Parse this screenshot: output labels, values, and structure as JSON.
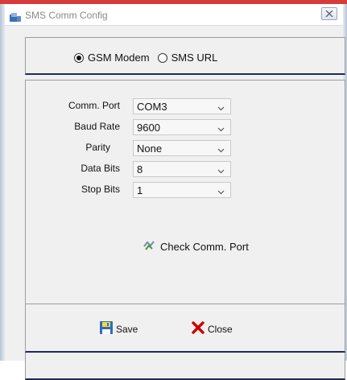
{
  "window": {
    "title": "SMS Comm Config",
    "app_icon": "sms-app-icon",
    "close_icon": "close-icon"
  },
  "mode": {
    "options": [
      {
        "label": "GSM Modem",
        "selected": true
      },
      {
        "label": "SMS URL",
        "selected": false
      }
    ]
  },
  "port_settings": {
    "comm_port": {
      "label": "Comm. Port",
      "value": "COM3"
    },
    "baud_rate": {
      "label": "Baud Rate",
      "value": "9600"
    },
    "parity": {
      "label": "Parity",
      "value": "None"
    },
    "data_bits": {
      "label": "Data Bits",
      "value": "8"
    },
    "stop_bits": {
      "label": "Stop Bits",
      "value": "1"
    },
    "check_button": {
      "label": "Check Comm. Port",
      "icon": "check-port-icon"
    }
  },
  "actions": {
    "save": {
      "label": "Save",
      "icon": "floppy-disk-icon"
    },
    "close": {
      "label": "Close",
      "icon": "red-x-icon"
    }
  },
  "colors": {
    "accent_top": "#d63a3a",
    "group_border_bottom": "#1e2a56",
    "close_x": "#cc0000"
  }
}
